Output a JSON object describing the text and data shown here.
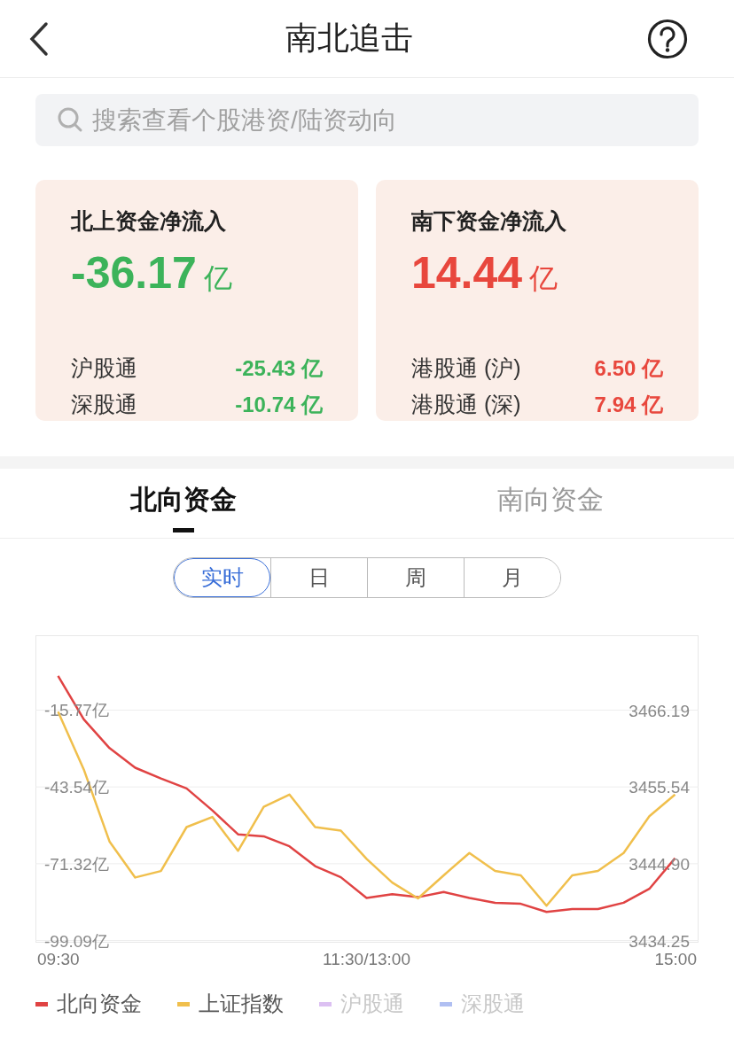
{
  "header": {
    "title": "南北追击"
  },
  "search": {
    "placeholder": "搜索查看个股港资/陆资动向"
  },
  "cards": [
    {
      "title": "北上资金净流入",
      "amount": "-36.17",
      "unit": "亿",
      "color": "#3cb35a",
      "rows": [
        {
          "label": "沪股通",
          "value": "-25.43 亿",
          "color": "#3cb35a"
        },
        {
          "label": "深股通",
          "value": "-10.74 亿",
          "color": "#3cb35a"
        }
      ]
    },
    {
      "title": "南下资金净流入",
      "amount": "14.44",
      "unit": "亿",
      "color": "#e8473d",
      "rows": [
        {
          "label": "港股通 (沪)",
          "value": "6.50 亿",
          "color": "#e8473d"
        },
        {
          "label": "港股通 (深)",
          "value": "7.94 亿",
          "color": "#e8473d"
        }
      ]
    }
  ],
  "tabs": [
    {
      "label": "北向资金",
      "selected": true
    },
    {
      "label": "南向资金",
      "selected": false
    }
  ],
  "periods": [
    {
      "label": "实时",
      "selected": true
    },
    {
      "label": "日",
      "selected": false
    },
    {
      "label": "周",
      "selected": false
    },
    {
      "label": "月",
      "selected": false
    }
  ],
  "chart": {
    "chart_data": {
      "type": "line",
      "categories": [
        "09:30",
        null,
        null,
        null,
        null,
        null,
        null,
        null,
        null,
        null,
        null,
        null,
        "11:30/13:00",
        null,
        null,
        null,
        null,
        null,
        null,
        null,
        null,
        null,
        null,
        null,
        "15:00"
      ],
      "grid": true,
      "ylim": [
        -99.54,
        11.29
      ],
      "yticks": [
        {
          "value": -15.77,
          "label": "-15.77亿"
        },
        {
          "value": -43.54,
          "label": "-43.54亿"
        },
        {
          "value": -71.32,
          "label": "-71.32亿"
        },
        {
          "value": -99.09,
          "label": "-99.09亿"
        }
      ],
      "y2lim": [
        3434.08,
        3476.6
      ],
      "y2ticks": [
        {
          "value": 3466.19,
          "label": "3466.19"
        },
        {
          "value": 3455.54,
          "label": "3455.54"
        },
        {
          "value": 3444.9,
          "label": "3444.90"
        },
        {
          "value": 3434.25,
          "label": "3434.25"
        }
      ],
      "series": [
        {
          "name": "北向资金",
          "color": "#e04343",
          "values": [
            -3.4,
            -19.1,
            -29.5,
            -36.6,
            -40.5,
            -44.1,
            -52.0,
            -60.7,
            -61.4,
            -65.0,
            -72.2,
            -76.2,
            -83.7,
            -82.3,
            -83.4,
            -81.5,
            -83.7,
            -85.4,
            -85.8,
            -88.7,
            -87.7,
            -87.7,
            -85.4,
            -80.4,
            -69.3
          ]
        },
        {
          "name": "上证指数",
          "color": "#f0bf4c",
          "axis": "y2",
          "values": [
            3466.0,
            3458.0,
            3448.0,
            3443.0,
            3443.9,
            3450.0,
            3451.4,
            3446.7,
            3452.8,
            3454.5,
            3450.0,
            3449.5,
            3445.6,
            3442.3,
            3440.1,
            3443.3,
            3446.4,
            3443.9,
            3443.3,
            3439.1,
            3443.3,
            3443.9,
            3446.4,
            3451.5,
            3454.5
          ]
        },
        {
          "name": "沪股通",
          "color": "#dcc0f2",
          "values": [
            null,
            null,
            null,
            null,
            null,
            null,
            null,
            null,
            null,
            null,
            null,
            null,
            null,
            null,
            null,
            null,
            null,
            null,
            null,
            null,
            null,
            null,
            null,
            null,
            null
          ]
        },
        {
          "name": "深股通",
          "color": "#b0bff2",
          "values": [
            null,
            null,
            null,
            null,
            null,
            null,
            null,
            null,
            null,
            null,
            null,
            null,
            null,
            null,
            null,
            null,
            null,
            null,
            null,
            null,
            null,
            null,
            null,
            null,
            null
          ]
        }
      ]
    }
  }
}
